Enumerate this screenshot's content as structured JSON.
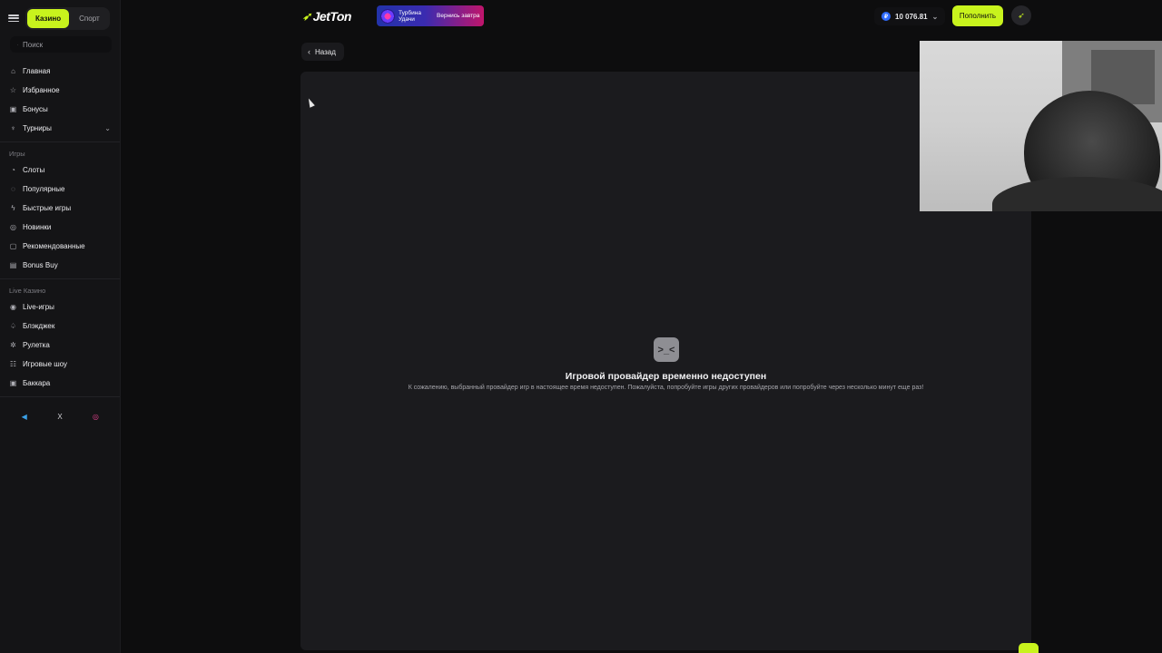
{
  "sidebar": {
    "tabs": [
      {
        "label": "Казино"
      },
      {
        "label": "Спорт"
      }
    ],
    "search_placeholder": "Поиск",
    "main_items": [
      {
        "label": "Главная",
        "icon": "home-icon"
      },
      {
        "label": "Избранное",
        "icon": "star-icon"
      },
      {
        "label": "Бонусы",
        "icon": "gift-icon"
      },
      {
        "label": "Турниры",
        "icon": "trophy-icon"
      }
    ],
    "games_title": "Игры",
    "games_items": [
      {
        "label": "Слоты",
        "icon": "slot-icon"
      },
      {
        "label": "Популярные",
        "icon": "fire-icon"
      },
      {
        "label": "Быстрые игры",
        "icon": "lightning-icon"
      },
      {
        "label": "Новинки",
        "icon": "new-icon"
      },
      {
        "label": "Рекомендованные",
        "icon": "recommended-icon"
      },
      {
        "label": "Bonus Buy",
        "icon": "bonus-buy-icon"
      }
    ],
    "live_title": "Live Казино",
    "live_items": [
      {
        "label": "Live-игры",
        "icon": "live-icon"
      },
      {
        "label": "Блэкджек",
        "icon": "spade-icon"
      },
      {
        "label": "Рулетка",
        "icon": "roulette-icon"
      },
      {
        "label": "Игровые шоу",
        "icon": "show-icon"
      },
      {
        "label": "Баккара",
        "icon": "cards-icon"
      }
    ],
    "socials": [
      {
        "icon": "telegram-icon",
        "glyph": "◀",
        "color": "#3aa0e6"
      },
      {
        "icon": "x-icon",
        "glyph": "X",
        "color": "#d0d0d4"
      },
      {
        "icon": "instagram-icon",
        "glyph": "◎",
        "color": "#e0408a"
      }
    ]
  },
  "header": {
    "logo": "JetTon",
    "promo_line1": "Турбина Удачи",
    "promo_line2": "Вернись завтра",
    "balance": "10 076.81",
    "currency_symbol": "₽",
    "deposit_label": "Пополнить"
  },
  "back_label": "Назад",
  "error": {
    "title": "Игровой провайдер временно недоступен",
    "message": "К сожалению, выбранный провайдер игр в настоящее время недоступен. Пожалуйста, попробуйте игры других провайдеров или попробуйте через несколько минут еще раз!"
  },
  "colors": {
    "accent": "#c8f31d",
    "background": "#0d0d0e",
    "panel": "#1b1b1e"
  }
}
